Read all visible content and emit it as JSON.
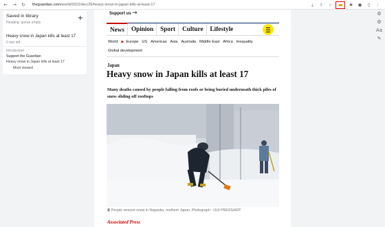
{
  "browser": {
    "url_domain": "theguardian.com",
    "url_path": "/world/2022/dec/26/heavy-snow-in-japan-kills-at-least-17",
    "nav_icons": [
      "back-icon",
      "forward-icon",
      "reload-icon"
    ],
    "highlight_color": "#e00000"
  },
  "reading_list": {
    "title": "Saved in library",
    "subtitle": "Heading: queue empty",
    "add_label": "+",
    "item_title": "Heavy snow in Japan kills at least 17",
    "item_meta": "0 min left",
    "intro_label": "Introduction",
    "section_heading": "Support the Guardian",
    "recent_item": "Heavy snow in Japan kills at least 17",
    "most_viewed": "Most viewed"
  },
  "page": {
    "support_label": "Support us",
    "support_arrow": "→",
    "pillars": [
      "News",
      "Opinion",
      "Sport",
      "Culture",
      "Lifestyle"
    ],
    "subnav": [
      "World",
      "Europe",
      "US",
      "Americas",
      "Asia",
      "Australia",
      "Middle East",
      "Africa",
      "Inequality"
    ],
    "subnav_row2": "Global development",
    "kicker": "Japan",
    "headline": "Heavy snow in Japan kills at least 17",
    "standfirst": "Many deaths caused by people falling from roofs or being buried underneath thick piles of snow sliding off rooftops",
    "caption": "People remove snow in Nagaoka, northern Japan. Photograph: -/JIJI PRESS/AFP",
    "byline": "Associated Press",
    "accent_red": "#c70000",
    "brand_navy": "#052962",
    "menu_yellow": "#ffe500"
  }
}
